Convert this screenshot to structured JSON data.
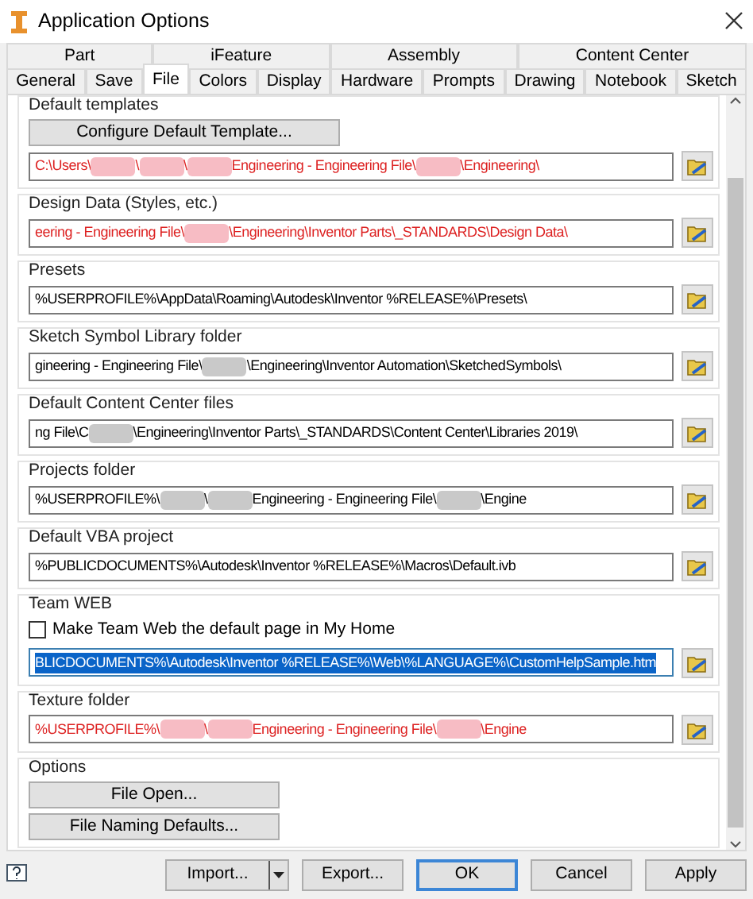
{
  "window": {
    "title": "Application Options"
  },
  "tab_rows": [
    [
      {
        "label": "Part",
        "selected": false
      },
      {
        "label": "iFeature",
        "selected": false
      },
      {
        "label": "Assembly",
        "selected": false
      },
      {
        "label": "Content Center",
        "selected": false
      }
    ],
    [
      {
        "label": "General",
        "selected": false
      },
      {
        "label": "Save",
        "selected": false
      },
      {
        "label": "File",
        "selected": true
      },
      {
        "label": "Colors",
        "selected": false
      },
      {
        "label": "Display",
        "selected": false
      },
      {
        "label": "Hardware",
        "selected": false
      },
      {
        "label": "Prompts",
        "selected": false
      },
      {
        "label": "Drawing",
        "selected": false
      },
      {
        "label": "Notebook",
        "selected": false
      },
      {
        "label": "Sketch",
        "selected": false
      }
    ]
  ],
  "sections": [
    {
      "label": "Default templates",
      "button": "Configure Default Template...",
      "path": {
        "invalid": true,
        "highlighted": false,
        "segments": [
          {
            "kind": "text",
            "text": "C:\\Users\\"
          },
          {
            "kind": "redacted"
          },
          {
            "kind": "text",
            "text": "\\"
          },
          {
            "kind": "redacted"
          },
          {
            "kind": "text",
            "text": "\\"
          },
          {
            "kind": "redacted"
          },
          {
            "kind": "text",
            "text": " Engineering - Engineering File\\"
          },
          {
            "kind": "redacted"
          },
          {
            "kind": "text",
            "text": "\\Engineering\\"
          }
        ]
      }
    },
    {
      "label": "Design Data (Styles, etc.)",
      "path": {
        "invalid": true,
        "highlighted": false,
        "segments": [
          {
            "kind": "text",
            "text": "eering - Engineering File\\"
          },
          {
            "kind": "redacted"
          },
          {
            "kind": "text",
            "text": "\\Engineering\\Inventor Parts\\_STANDARDS\\Design Data\\"
          }
        ]
      }
    },
    {
      "label": "Presets",
      "path": {
        "invalid": false,
        "highlighted": false,
        "segments": [
          {
            "kind": "text",
            "text": "%USERPROFILE%\\AppData\\Roaming\\Autodesk\\Inventor %RELEASE%\\Presets\\"
          }
        ]
      }
    },
    {
      "label": "Sketch Symbol Library folder",
      "path": {
        "invalid": false,
        "highlighted": false,
        "segments": [
          {
            "kind": "text",
            "text": "gineering - Engineering File\\"
          },
          {
            "kind": "redacted"
          },
          {
            "kind": "text",
            "text": "\\Engineering\\Inventor Automation\\SketchedSymbols\\"
          }
        ]
      }
    },
    {
      "label": "Default Content Center files",
      "path": {
        "invalid": false,
        "highlighted": false,
        "segments": [
          {
            "kind": "text",
            "text": "ng File\\C"
          },
          {
            "kind": "redacted"
          },
          {
            "kind": "text",
            "text": "\\Engineering\\Inventor Parts\\_STANDARDS\\Content Center\\Libraries 2019\\"
          }
        ]
      }
    },
    {
      "label": "Projects folder",
      "path": {
        "invalid": false,
        "highlighted": false,
        "segments": [
          {
            "kind": "text",
            "text": "%USERPROFILE%\\"
          },
          {
            "kind": "redacted"
          },
          {
            "kind": "text",
            "text": "\\"
          },
          {
            "kind": "redacted"
          },
          {
            "kind": "text",
            "text": " Engineering - Engineering File\\"
          },
          {
            "kind": "redacted"
          },
          {
            "kind": "text",
            "text": "\\Engine"
          }
        ]
      }
    },
    {
      "label": "Default VBA project",
      "path": {
        "invalid": false,
        "highlighted": false,
        "segments": [
          {
            "kind": "text",
            "text": "%PUBLICDOCUMENTS%\\Autodesk\\Inventor %RELEASE%\\Macros\\Default.ivb"
          }
        ]
      }
    },
    {
      "label": "Team WEB",
      "checkbox": {
        "label": "Make Team Web the default page in My Home",
        "checked": false
      },
      "path": {
        "invalid": false,
        "highlighted": true,
        "segments": [
          {
            "kind": "text",
            "text": "BLICDOCUMENTS%\\Autodesk\\Inventor %RELEASE%\\Web\\%LANGUAGE%\\CustomHelpSample.htm"
          }
        ]
      }
    },
    {
      "label": "Texture folder",
      "path": {
        "invalid": true,
        "highlighted": false,
        "segments": [
          {
            "kind": "text",
            "text": "%USERPROFILE%\\"
          },
          {
            "kind": "redacted"
          },
          {
            "kind": "text",
            "text": "\\"
          },
          {
            "kind": "redacted"
          },
          {
            "kind": "text",
            "text": " Engineering - Engineering File\\"
          },
          {
            "kind": "redacted"
          },
          {
            "kind": "text",
            "text": "\\Engine"
          }
        ]
      }
    },
    {
      "label": "Options",
      "buttons": [
        "File Open...",
        "File Naming Defaults..."
      ]
    }
  ],
  "footer": [
    {
      "kind": "split",
      "label": "Import..."
    },
    {
      "kind": "plain",
      "label": "Export..."
    },
    {
      "kind": "default",
      "label": "OK"
    },
    {
      "kind": "plain",
      "label": "Cancel"
    },
    {
      "kind": "plain",
      "label": "Apply"
    }
  ]
}
